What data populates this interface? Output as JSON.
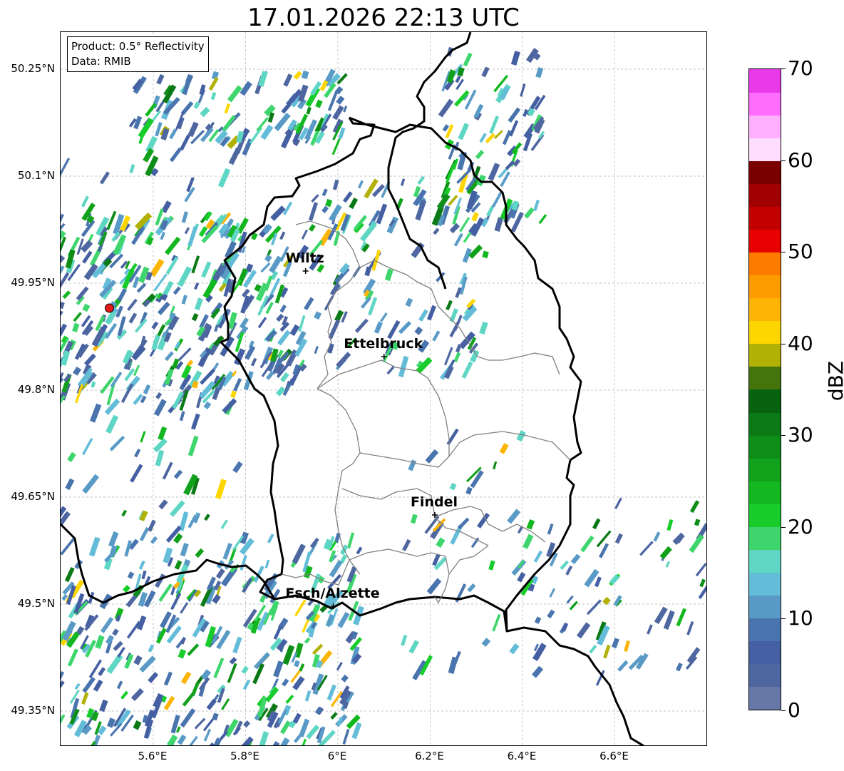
{
  "title": "17.01.2026 22:13 UTC",
  "info": {
    "product": "Product: 0.5° Reflectivity",
    "source": "Data: RMIB"
  },
  "axes": {
    "lon_min": 5.4,
    "lon_max": 6.8,
    "lat_min": 49.3,
    "lat_max": 50.3,
    "lat_ticks": [
      {
        "value": 50.25,
        "label": "50.25°N"
      },
      {
        "value": 50.1,
        "label": "50.1°N"
      },
      {
        "value": 49.95,
        "label": "49.95°N"
      },
      {
        "value": 49.8,
        "label": "49.8°N"
      },
      {
        "value": 49.65,
        "label": "49.65°N"
      },
      {
        "value": 49.5,
        "label": "49.5°N"
      },
      {
        "value": 49.35,
        "label": "49.35°N"
      }
    ],
    "lon_ticks": [
      {
        "value": 5.6,
        "label": "5.6°E"
      },
      {
        "value": 5.8,
        "label": "5.8°E"
      },
      {
        "value": 6.0,
        "label": "6°E"
      },
      {
        "value": 6.2,
        "label": "6.2°E"
      },
      {
        "value": 6.4,
        "label": "6.4°E"
      },
      {
        "value": 6.6,
        "label": "6.6°E"
      }
    ],
    "grid": true
  },
  "cities": [
    {
      "name": "Wiltz",
      "lon": 5.93,
      "lat": 49.967
    },
    {
      "name": "Ettelbruck",
      "lon": 6.1,
      "lat": 49.847
    },
    {
      "name": "Findel",
      "lon": 6.21,
      "lat": 49.625
    },
    {
      "name": "Esch/Alzette",
      "lon": 5.99,
      "lat": 49.497
    }
  ],
  "radar_site": {
    "lon": 5.505,
    "lat": 49.915,
    "color": "#e31a1c"
  },
  "colorbar": {
    "title": "dBZ",
    "min": 0,
    "max": 70,
    "tick_values": [
      0,
      10,
      20,
      30,
      40,
      50,
      60,
      70
    ],
    "tick_labels": [
      "0",
      "10",
      "20",
      "30",
      "40",
      "50",
      "60",
      "70"
    ],
    "colors": [
      "#6677a8",
      "#4f67a0",
      "#4560a2",
      "#4a74ad",
      "#599bc6",
      "#63bdd8",
      "#5fd6c4",
      "#3ed66c",
      "#17cc2b",
      "#13b71f",
      "#11a11b",
      "#0e8d18",
      "#0b7915",
      "#086310",
      "#44750d",
      "#b1b108",
      "#fdd600",
      "#fdb405",
      "#fd9b00",
      "#fd7c00",
      "#e60000",
      "#c30000",
      "#a00000",
      "#7a0000",
      "#ffddff",
      "#ffb1ff",
      "#ff6dff",
      "#e93ae9"
    ]
  },
  "boundary_color": "#000000",
  "canton_color": "#808080"
}
